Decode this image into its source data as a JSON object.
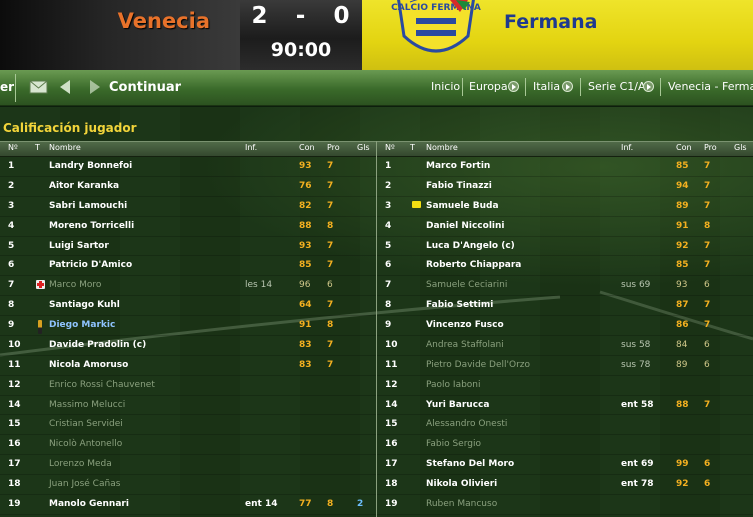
{
  "scoreboard": {
    "home_team": "Venecia",
    "away_team": "Fermana",
    "home_goals": "2",
    "separator": "-",
    "away_goals": "0",
    "clock": "90:00",
    "crest_text": "CALCIO FERMANA"
  },
  "nav": {
    "left_label_partial": "er",
    "continue_label": "Continuar",
    "breadcrumbs": [
      "Inicio",
      "Europa",
      "Italia",
      "Serie C1/A",
      "Venecia - Fermana"
    ],
    "icons": [
      "mail-icon",
      "back-arrow-icon",
      "forward-arrow-icon"
    ]
  },
  "panel": {
    "title": "Calificación jugador"
  },
  "columns": {
    "num": "Nº",
    "t": "T",
    "name": "Nombre",
    "inf": "Inf.",
    "con": "Con",
    "pro": "Pro",
    "gls": "Gls"
  },
  "home_players": [
    {
      "num": "1",
      "name": "Landry Bonnefoi",
      "inf": "",
      "con": "93",
      "pro": "7",
      "gls": "",
      "played": true
    },
    {
      "num": "2",
      "name": "Aitor Karanka",
      "inf": "",
      "con": "76",
      "pro": "7",
      "gls": "",
      "played": true
    },
    {
      "num": "3",
      "name": "Sabri Lamouchi",
      "inf": "",
      "con": "82",
      "pro": "7",
      "gls": "",
      "played": true
    },
    {
      "num": "4",
      "name": "Moreno Torricelli",
      "inf": "",
      "con": "88",
      "pro": "8",
      "gls": "",
      "played": true
    },
    {
      "num": "5",
      "name": "Luigi Sartor",
      "inf": "",
      "con": "93",
      "pro": "7",
      "gls": "",
      "played": true
    },
    {
      "num": "6",
      "name": "Patricio D'Amico",
      "inf": "",
      "con": "85",
      "pro": "7",
      "gls": "",
      "played": true
    },
    {
      "num": "7",
      "name": "Marco Moro",
      "inf": "les 14",
      "con": "96",
      "pro": "6",
      "gls": "",
      "played": false,
      "icon": "injury-icon"
    },
    {
      "num": "8",
      "name": "Santiago Kuhl",
      "inf": "",
      "con": "64",
      "pro": "7",
      "gls": "",
      "played": true
    },
    {
      "num": "9",
      "name": "Diego Markic",
      "inf": "",
      "con": "91",
      "pro": "8",
      "gls": "",
      "played": true,
      "icon": "boot-icon",
      "highlight": true
    },
    {
      "num": "10",
      "name": "Davide Pradolin (c)",
      "inf": "",
      "con": "83",
      "pro": "7",
      "gls": "",
      "played": true
    },
    {
      "num": "11",
      "name": "Nicola Amoruso",
      "inf": "",
      "con": "83",
      "pro": "7",
      "gls": "",
      "played": true
    },
    {
      "num": "12",
      "name": "Enrico Rossi Chauvenet",
      "inf": "",
      "con": "",
      "pro": "",
      "gls": "",
      "played": false
    },
    {
      "num": "14",
      "name": "Massimo Melucci",
      "inf": "",
      "con": "",
      "pro": "",
      "gls": "",
      "played": false
    },
    {
      "num": "15",
      "name": "Cristian Servidei",
      "inf": "",
      "con": "",
      "pro": "",
      "gls": "",
      "played": false
    },
    {
      "num": "16",
      "name": "Nicolò Antonello",
      "inf": "",
      "con": "",
      "pro": "",
      "gls": "",
      "played": false
    },
    {
      "num": "17",
      "name": "Lorenzo Meda",
      "inf": "",
      "con": "",
      "pro": "",
      "gls": "",
      "played": false
    },
    {
      "num": "18",
      "name": "Juan José Cañas",
      "inf": "",
      "con": "",
      "pro": "",
      "gls": "",
      "played": false
    },
    {
      "num": "19",
      "name": "Manolo Gennari",
      "inf": "ent 14",
      "con": "77",
      "pro": "8",
      "gls": "2",
      "played": true
    }
  ],
  "away_players": [
    {
      "num": "1",
      "name": "Marco Fortin",
      "inf": "",
      "con": "85",
      "pro": "7",
      "gls": "",
      "played": true
    },
    {
      "num": "2",
      "name": "Fabio Tinazzi",
      "inf": "",
      "con": "94",
      "pro": "7",
      "gls": "",
      "played": true
    },
    {
      "num": "3",
      "name": "Samuele Buda",
      "inf": "",
      "con": "89",
      "pro": "7",
      "gls": "",
      "played": true,
      "icon": "yellow-card-icon"
    },
    {
      "num": "4",
      "name": "Daniel Niccolini",
      "inf": "",
      "con": "91",
      "pro": "8",
      "gls": "",
      "played": true
    },
    {
      "num": "5",
      "name": "Luca D'Angelo (c)",
      "inf": "",
      "con": "92",
      "pro": "7",
      "gls": "",
      "played": true
    },
    {
      "num": "6",
      "name": "Roberto Chiappara",
      "inf": "",
      "con": "85",
      "pro": "7",
      "gls": "",
      "played": true
    },
    {
      "num": "7",
      "name": "Samuele Ceciarini",
      "inf": "sus 69",
      "con": "93",
      "pro": "6",
      "gls": "",
      "played": false
    },
    {
      "num": "8",
      "name": "Fabio Settimi",
      "inf": "",
      "con": "87",
      "pro": "7",
      "gls": "",
      "played": true
    },
    {
      "num": "9",
      "name": "Vincenzo Fusco",
      "inf": "",
      "con": "86",
      "pro": "7",
      "gls": "",
      "played": true
    },
    {
      "num": "10",
      "name": "Andrea Staffolani",
      "inf": "sus 58",
      "con": "84",
      "pro": "6",
      "gls": "",
      "played": false
    },
    {
      "num": "11",
      "name": "Pietro Davide Dell'Orzo",
      "inf": "sus 78",
      "con": "89",
      "pro": "6",
      "gls": "",
      "played": false
    },
    {
      "num": "12",
      "name": "Paolo Iaboni",
      "inf": "",
      "con": "",
      "pro": "",
      "gls": "",
      "played": false
    },
    {
      "num": "14",
      "name": "Yuri Barucca",
      "inf": "ent 58",
      "con": "88",
      "pro": "7",
      "gls": "",
      "played": true
    },
    {
      "num": "15",
      "name": "Alessandro Onesti",
      "inf": "",
      "con": "",
      "pro": "",
      "gls": "",
      "played": false
    },
    {
      "num": "16",
      "name": "Fabio Sergio",
      "inf": "",
      "con": "",
      "pro": "",
      "gls": "",
      "played": false
    },
    {
      "num": "17",
      "name": "Stefano Del Moro",
      "inf": "ent 69",
      "con": "99",
      "pro": "6",
      "gls": "",
      "played": true
    },
    {
      "num": "18",
      "name": "Nikola Olivieri",
      "inf": "ent 78",
      "con": "92",
      "pro": "6",
      "gls": "",
      "played": true
    },
    {
      "num": "19",
      "name": "Ruben Mancuso",
      "inf": "",
      "con": "",
      "pro": "",
      "gls": "",
      "played": false
    }
  ],
  "colors": {
    "home_accent": "#e8722a",
    "away_accent": "#1f3a8f",
    "away_bg": "#e3d411",
    "title": "#f2d43a",
    "rating": "#f3b020",
    "goals": "#6ec0ff"
  }
}
